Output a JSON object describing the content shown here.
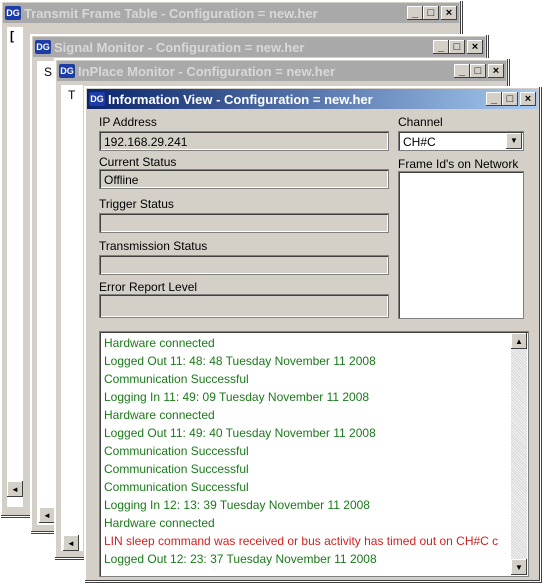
{
  "windows": {
    "transmit": {
      "title": "Transmit Frame Table  - Configuration = new.her",
      "tab": "["
    },
    "signal": {
      "title": "Signal Monitor  - Configuration = new.her",
      "tab": "S"
    },
    "inplace": {
      "title": "InPlace Monitor  - Configuration = new.her",
      "tab": "T"
    },
    "info": {
      "title": "Information View  - Configuration = new.her"
    }
  },
  "controls": {
    "minimize": "_",
    "maximize": "□",
    "close": "×",
    "app_icon": "DG"
  },
  "info_view": {
    "ip_label": "IP Address",
    "ip_value": "192.168.29.241",
    "current_status_label": "Current Status",
    "current_status_value": "Offline",
    "trigger_status_label": "Trigger Status",
    "trigger_status_value": "",
    "transmission_status_label": "Transmission Status",
    "transmission_status_value": "",
    "error_report_label": "Error Report Level",
    "error_report_value": "",
    "channel_label": "Channel",
    "channel_value": "CH#C",
    "frame_ids_label": "Frame Id's on Network"
  },
  "log": [
    {
      "text": "Hardware connected",
      "color": "green"
    },
    {
      "text": "Logged Out 11: 48: 48  Tuesday November 11 2008",
      "color": "green"
    },
    {
      "text": "Communication Successful",
      "color": "green"
    },
    {
      "text": "Logging In 11: 49: 09  Tuesday November 11 2008",
      "color": "green"
    },
    {
      "text": "Hardware connected",
      "color": "green"
    },
    {
      "text": "Logged Out 11: 49: 40  Tuesday November 11 2008",
      "color": "green"
    },
    {
      "text": "Communication Successful",
      "color": "green"
    },
    {
      "text": "Communication Successful",
      "color": "green"
    },
    {
      "text": "Communication Successful",
      "color": "green"
    },
    {
      "text": "Logging In 12: 13: 39  Tuesday November 11 2008",
      "color": "green"
    },
    {
      "text": "Hardware connected",
      "color": "green"
    },
    {
      "text": "LIN sleep command was received or bus activity has timed out on CH#C c",
      "color": "red"
    },
    {
      "text": "Logged Out 12: 23: 37  Tuesday November 11 2008",
      "color": "green"
    }
  ]
}
